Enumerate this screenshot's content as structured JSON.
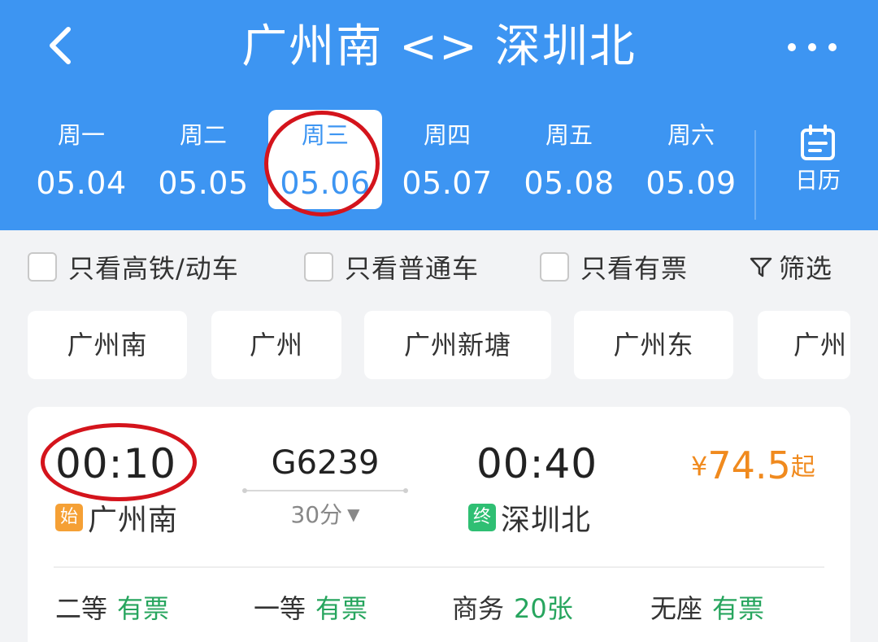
{
  "header": {
    "title": "广州南 <> 深圳北",
    "back_icon": "back-chevron-icon",
    "more_icon": "more-dots-icon",
    "background_color": "#3d95f2"
  },
  "dates": [
    {
      "weekday": "周一",
      "date": "05.04",
      "selected": false
    },
    {
      "weekday": "周二",
      "date": "05.05",
      "selected": false
    },
    {
      "weekday": "周三",
      "date": "05.06",
      "selected": true
    },
    {
      "weekday": "周四",
      "date": "05.07",
      "selected": false
    },
    {
      "weekday": "周五",
      "date": "05.08",
      "selected": false
    },
    {
      "weekday": "周六",
      "date": "05.09",
      "selected": false
    }
  ],
  "calendar": {
    "label": "日历",
    "icon": "calendar-icon"
  },
  "filters": {
    "high_speed_only": {
      "label": "只看高铁/动车",
      "checked": false
    },
    "regular_only": {
      "label": "只看普通车",
      "checked": false
    },
    "available_only": {
      "label": "只看有票",
      "checked": false
    },
    "filter_button": {
      "label": "筛选",
      "icon": "funnel-icon"
    }
  },
  "stations": [
    "广州南",
    "广州",
    "广州新塘",
    "广州东",
    "广州"
  ],
  "train": {
    "departure_time": "00:10",
    "train_number": "G6239",
    "duration": "30分",
    "arrival_time": "00:40",
    "price_symbol": "¥",
    "price": "74.5",
    "price_suffix": "起",
    "origin_tag": "始",
    "origin_station": "广州南",
    "terminal_tag": "终",
    "terminal_station": "深圳北",
    "seats": [
      {
        "class": "二等",
        "availability": "有票"
      },
      {
        "class": "一等",
        "availability": "有票"
      },
      {
        "class": "商务",
        "availability": "20张"
      },
      {
        "class": "无座",
        "availability": "有票"
      }
    ]
  },
  "colors": {
    "accent": "#3d95f2",
    "price": "#f08a1e",
    "available": "#27a55e",
    "origin_tag": "#f5a035",
    "terminal_tag": "#2fbf73",
    "annotation_circle": "#d4141c"
  }
}
